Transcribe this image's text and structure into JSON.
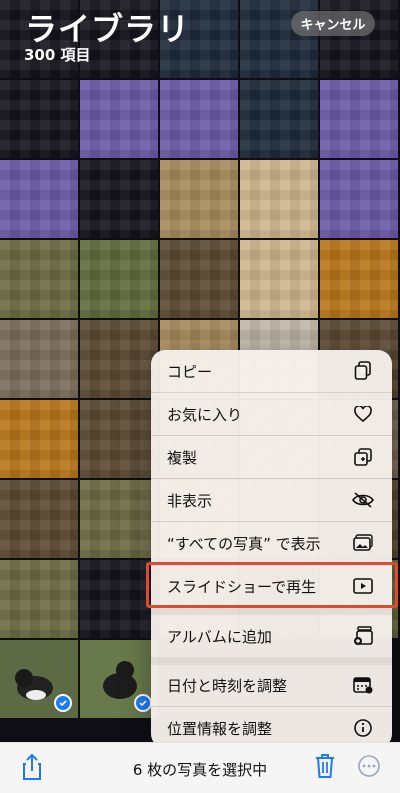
{
  "header": {
    "title": "ライブラリ",
    "count": "300 項目",
    "cancel_label": "キャンセル"
  },
  "menu": {
    "items": [
      {
        "label": "コピー",
        "icon": "copy-icon"
      },
      {
        "label": "お気に入り",
        "icon": "heart-icon"
      },
      {
        "label": "複製",
        "icon": "duplicate-icon"
      },
      {
        "label": "非表示",
        "icon": "eye-slash-icon"
      },
      {
        "label": "“すべての写真” で表示",
        "icon": "photo-icon"
      },
      {
        "label": "スライドショーで再生",
        "icon": "play-icon"
      },
      {
        "label": "アルバムに追加",
        "icon": "add-to-album-icon"
      },
      {
        "label": "日付と時刻を調整",
        "icon": "calendar-icon"
      },
      {
        "label": "位置情報を調整",
        "icon": "info-icon"
      }
    ]
  },
  "bottom_bar": {
    "selection_text": "6 枚の写真を選択中"
  },
  "colors": {
    "accent": "#1e7bf6",
    "highlight_border": "#e04a2e"
  }
}
